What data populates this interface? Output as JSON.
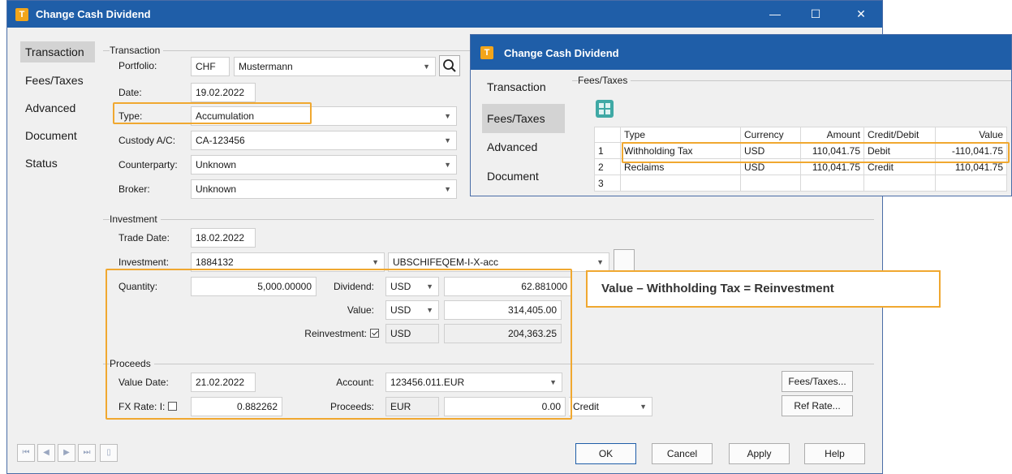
{
  "main": {
    "title": "Change Cash Dividend",
    "logo_letter": "T",
    "window_controls": {
      "minimize": "—",
      "maximize": "☐",
      "close": "✕"
    },
    "nav": [
      "Transaction",
      "Fees/Taxes",
      "Advanced",
      "Document",
      "Status"
    ],
    "transaction_group": {
      "label": "Transaction",
      "portfolio_label": "Portfolio:",
      "portfolio_code": "CHF",
      "portfolio_name": "Mustermann",
      "date_label": "Date:",
      "date": "19.02.2022",
      "type_label": "Type:",
      "type": "Accumulation",
      "custody_label": "Custody A/C:",
      "custody": "CA-123456",
      "counterparty_label": "Counterparty:",
      "counterparty": "Unknown",
      "broker_label": "Broker:",
      "broker": "Unknown"
    },
    "investment_group": {
      "label": "Investment",
      "trade_date_label": "Trade Date:",
      "trade_date": "18.02.2022",
      "investment_label": "Investment:",
      "investment_id": "1884132",
      "investment_name": "UBSCHIFEQEM-I-X-acc",
      "quantity_label": "Quantity:",
      "quantity": "5,000.00000",
      "dividend_label": "Dividend:",
      "dividend_currency": "USD",
      "dividend": "62.881000",
      "value_label": "Value:",
      "value_currency": "USD",
      "value": "314,405.00",
      "reinvestment_label": "Reinvestment:",
      "reinvestment_checked": true,
      "reinvestment_currency": "USD",
      "reinvestment": "204,363.25"
    },
    "proceeds_group": {
      "label": "Proceeds",
      "value_date_label": "Value Date:",
      "value_date": "21.02.2022",
      "account_label": "Account:",
      "account": "123456.011.EUR",
      "fx_rate_label": "FX Rate:",
      "fx_i_label": "I:",
      "fx_rate": "0.882262",
      "proceeds_label": "Proceeds:",
      "proceeds_currency": "EUR",
      "proceeds": "0.00",
      "credit_debit": "Credit"
    },
    "side_buttons": {
      "fees_taxes": "Fees/Taxes...",
      "ref_rate": "Ref Rate..."
    },
    "footer_buttons": {
      "ok": "OK",
      "cancel": "Cancel",
      "apply": "Apply",
      "help": "Help"
    }
  },
  "popup": {
    "title": "Change Cash Dividend",
    "logo_letter": "T",
    "nav": [
      "Transaction",
      "Fees/Taxes",
      "Advanced",
      "Document"
    ],
    "group_label": "Fees/Taxes",
    "columns": [
      "",
      "Type",
      "Currency",
      "Amount",
      "Credit/Debit",
      "Value"
    ],
    "rows": [
      {
        "n": "1",
        "type": "Withholding Tax",
        "currency": "USD",
        "amount": "110,041.75",
        "cd": "Debit",
        "value": "-110,041.75"
      },
      {
        "n": "2",
        "type": "Reclaims",
        "currency": "USD",
        "amount": "110,041.75",
        "cd": "Credit",
        "value": "110,041.75"
      },
      {
        "n": "3",
        "type": "",
        "currency": "",
        "amount": "",
        "cd": "",
        "value": ""
      }
    ]
  },
  "callout": "Value – Withholding Tax = Reinvestment",
  "colors": {
    "titlebar": "#1f5ea8",
    "highlight": "#f0a830",
    "logo": "#f2a51a"
  }
}
